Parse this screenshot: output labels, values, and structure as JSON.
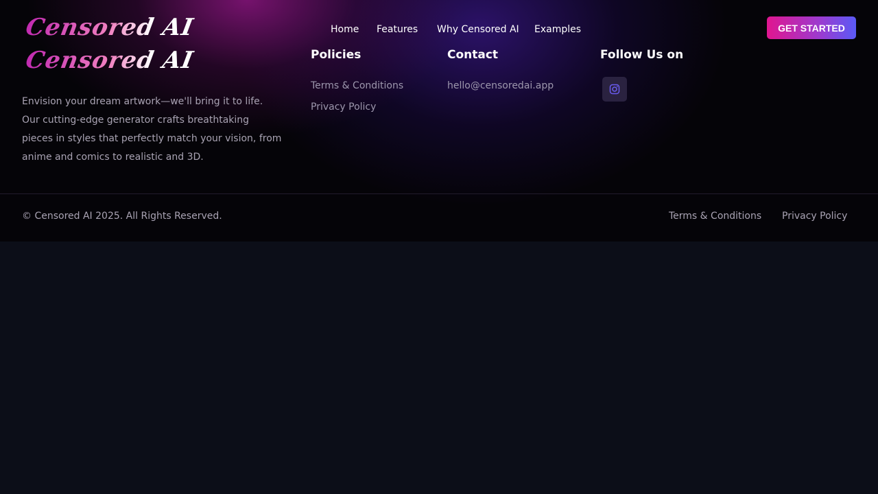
{
  "brand": {
    "logo_text": "Censored AI",
    "logo_text_2": "Censored AI",
    "description": "Envision your dream artwork—we'll bring it to life. Our cutting-edge generator crafts breathtaking pieces in styles that perfectly match your vision, from anime and comics to realistic and 3D."
  },
  "nav": {
    "items": [
      "Home",
      "Features",
      "Why Censored AI",
      "Examples"
    ],
    "cta": "GET STARTED"
  },
  "policies": {
    "title": "Policies",
    "links": [
      "Terms & Conditions",
      "Privacy Policy"
    ]
  },
  "contact": {
    "title": "Contact",
    "email": "hello@censoredai.app"
  },
  "follow": {
    "title": "Follow Us on",
    "icons": [
      "instagram-icon"
    ]
  },
  "bottom": {
    "copyright": "© Censored AI 2025. All Rights Reserved.",
    "links": [
      "Terms & Conditions",
      "Privacy Policy"
    ]
  },
  "colors": {
    "accent_pink": "#e0168f",
    "accent_blue": "#5a5af5",
    "background": "#0c0e18"
  }
}
